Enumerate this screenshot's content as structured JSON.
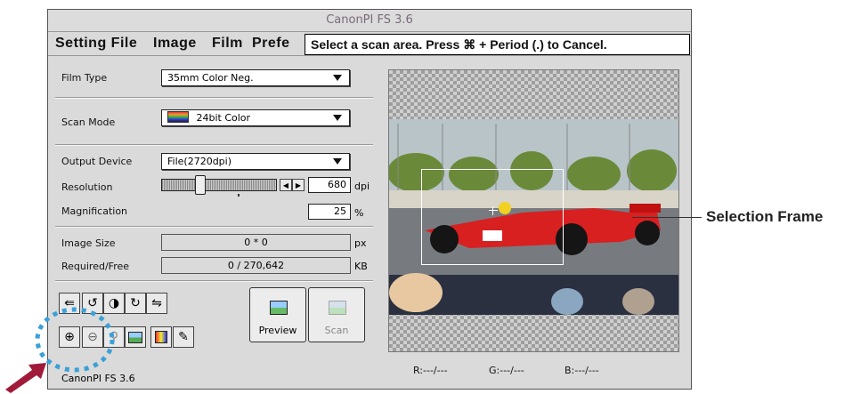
{
  "window": {
    "title": "CanonPI FS 3.6"
  },
  "menu": [
    "Setting File",
    "Image",
    "Film",
    "Prefe"
  ],
  "tooltip": "Select a scan area. Press ⌘ + Period (.) to Cancel.",
  "settings": {
    "film_type_label": "Film Type",
    "film_type_value": "35mm Color Neg.",
    "scan_mode_label": "Scan Mode",
    "scan_mode_value": "24bit Color",
    "output_device_label": "Output Device",
    "output_device_value": "File(2720dpi)",
    "resolution_label": "Resolution",
    "resolution_value": "680",
    "resolution_unit": "dpi",
    "magnification_label": "Magnification",
    "magnification_value": "25",
    "magnification_unit": "%",
    "image_size_label": "Image Size",
    "image_size_value": "0 * 0",
    "image_size_unit": "px",
    "required_free_label": "Required/Free",
    "required_free_value": "0 / 270,642",
    "required_free_unit": "KB"
  },
  "buttons": {
    "preview": "Preview",
    "scan": "Scan"
  },
  "readout": {
    "r": "R:---/---",
    "g": "G:---/---",
    "b": "B:---/---"
  },
  "status": "CanonPI FS 3.6",
  "callout": "Selection Frame",
  "icons": [
    "rotate-left-icon",
    "flip-icon",
    "rotate-right-icon",
    "mirror-icon",
    "zoom-in-icon",
    "zoom-out-icon",
    "magnifier-icon",
    "fit-image-icon",
    "color-adjust-icon",
    "eyedropper-icon",
    "preview-icon",
    "scan-icon"
  ],
  "colors": {
    "window_bg": "#dadada",
    "highlight_dashes": "#3aa0d8",
    "arrow": "#a01a3a"
  }
}
